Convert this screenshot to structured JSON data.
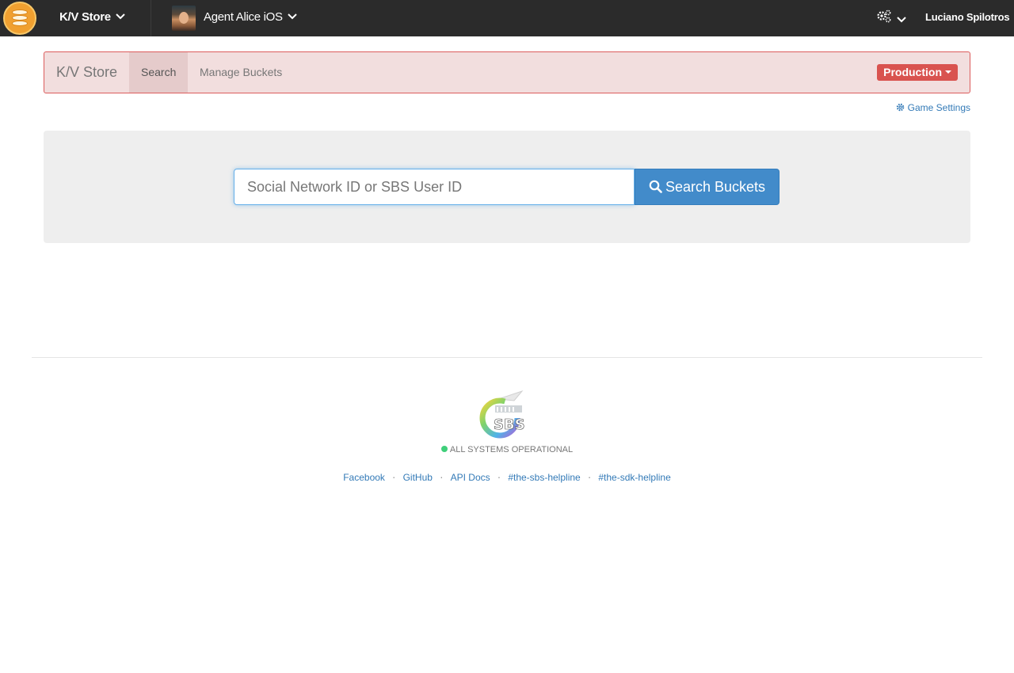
{
  "topbar": {
    "app_name": "K/V Store",
    "game_name": "Agent Alice iOS",
    "user_name": "Luciano Spilotros",
    "icons": [
      "database-icon",
      "chevron-down-icon",
      "gears-icon"
    ]
  },
  "subnav": {
    "brand": "K/V Store",
    "tabs": [
      {
        "label": "Search",
        "active": true
      },
      {
        "label": "Manage Buckets",
        "active": false
      }
    ],
    "environment": "Production",
    "environment_color": "#d9534f",
    "background_color": "#f2dede"
  },
  "game_settings": {
    "label": "Game Settings",
    "icon": "gear-icon"
  },
  "search": {
    "placeholder": "Social Network ID or SBS User ID",
    "value": "",
    "button_label": "Search Buckets",
    "button_color": "#428bca"
  },
  "footer": {
    "logo_text": "SBS",
    "status": "ALL SYSTEMS OPERATIONAL",
    "status_color": "#3fcf7a",
    "links": [
      "Facebook",
      "GitHub",
      "API Docs",
      "#the-sbs-helpline",
      "#the-sdk-helpline"
    ]
  }
}
